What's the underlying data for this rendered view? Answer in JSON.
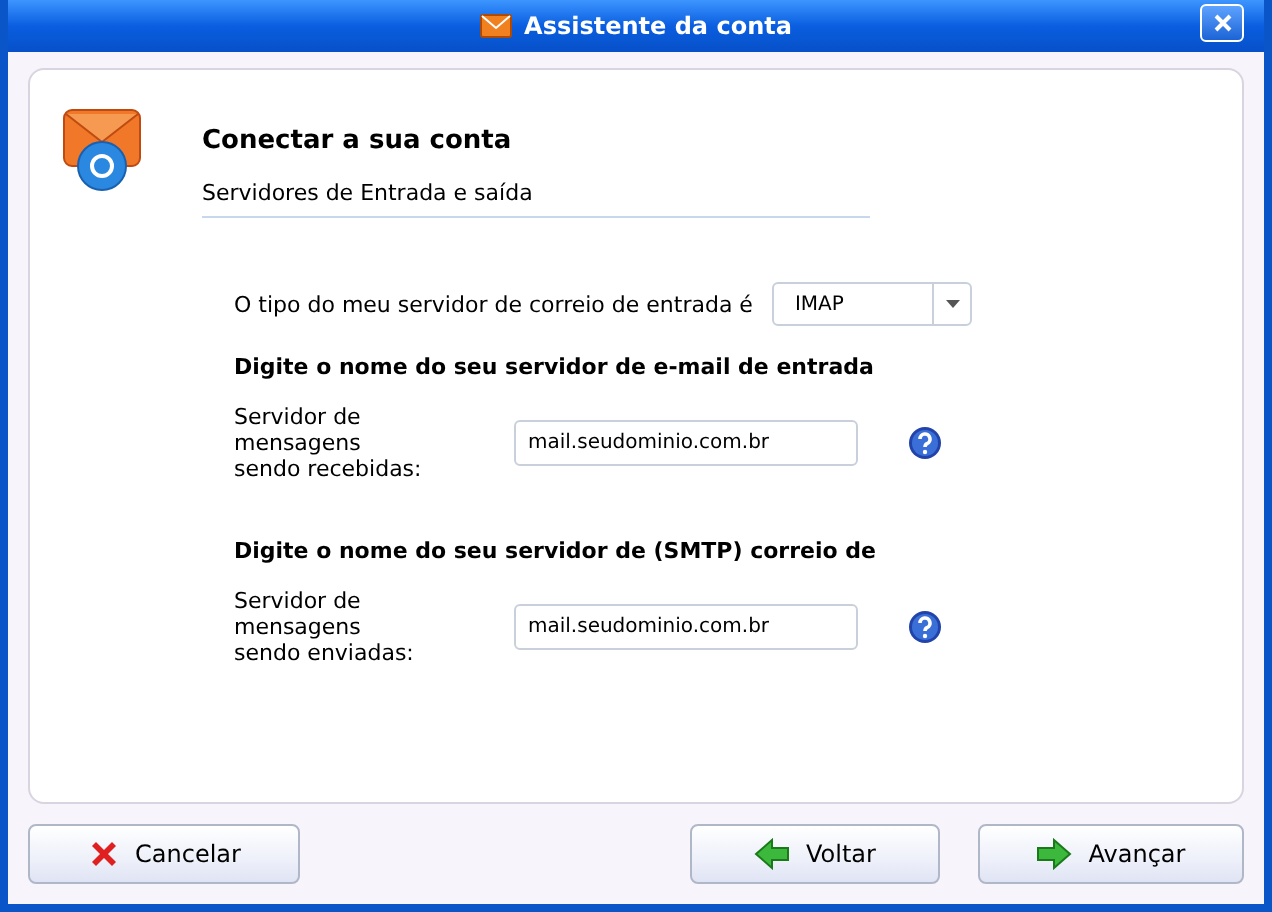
{
  "window": {
    "title": "Assistente da conta"
  },
  "header": {
    "title": "Conectar a sua conta",
    "subtitle": "Servidores de Entrada e saída"
  },
  "server_type": {
    "label": "O tipo do meu servidor de correio de entrada é",
    "value": "IMAP"
  },
  "sections": [
    {
      "heading": "Digite o nome do seu servidor de e-mail de entrada",
      "label_line1": "Servidor de mensagens",
      "label_line2": "sendo recebidas:",
      "value": "mail.seudominio.com.br"
    },
    {
      "heading": "Digite o nome do seu servidor de (SMTP) correio de",
      "label_line1": "Servidor de mensagens",
      "label_line2": "sendo enviadas:",
      "value": "mail.seudominio.com.br"
    }
  ],
  "buttons": [
    {
      "kind": "cancel",
      "label": "Cancelar"
    },
    {
      "kind": "back",
      "label": "Voltar"
    },
    {
      "kind": "next",
      "label": "Avançar"
    }
  ]
}
